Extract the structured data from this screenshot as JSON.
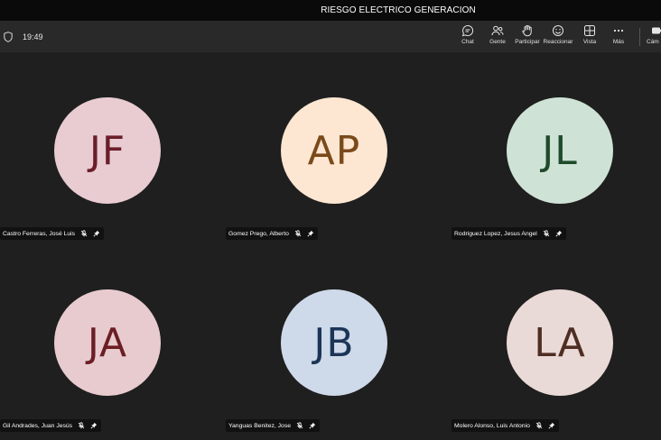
{
  "window": {
    "title": "RIESGO ELECTRICO GENERACION"
  },
  "toolbar": {
    "time": "19:49",
    "buttons": [
      {
        "label": "Chat",
        "icon": "chat-icon"
      },
      {
        "label": "Gente",
        "icon": "people-icon"
      },
      {
        "label": "Participar",
        "icon": "raise-hand-icon"
      },
      {
        "label": "Reaccionar",
        "icon": "smiley-icon"
      },
      {
        "label": "Vista",
        "icon": "grid-view-icon"
      },
      {
        "label": "Más",
        "icon": "more-icon"
      },
      {
        "label": "Cám",
        "icon": "camera-icon"
      }
    ]
  },
  "participants": [
    {
      "initials": "JF",
      "name": "Castro Ferreras, José Luis",
      "bg": "#e8ccd1",
      "fg": "#6b1e2a"
    },
    {
      "initials": "AP",
      "name": "Gomez Prego, Alberto",
      "bg": "#fde7d2",
      "fg": "#7a4a1a"
    },
    {
      "initials": "JL",
      "name": "Rodriguez Lopez, Jesus Angel",
      "bg": "#cfe2d6",
      "fg": "#1f4a2c"
    },
    {
      "initials": "JA",
      "name": "Gil Andrades, Juan Jesús",
      "bg": "#e8cbcf",
      "fg": "#6b1e24"
    },
    {
      "initials": "JB",
      "name": "Yanguas Benitez, Jose",
      "bg": "#cedaea",
      "fg": "#1c3557"
    },
    {
      "initials": "LA",
      "name": "Molero Alonso, Luis Antonio",
      "bg": "#eadad7",
      "fg": "#4e2e24"
    }
  ]
}
